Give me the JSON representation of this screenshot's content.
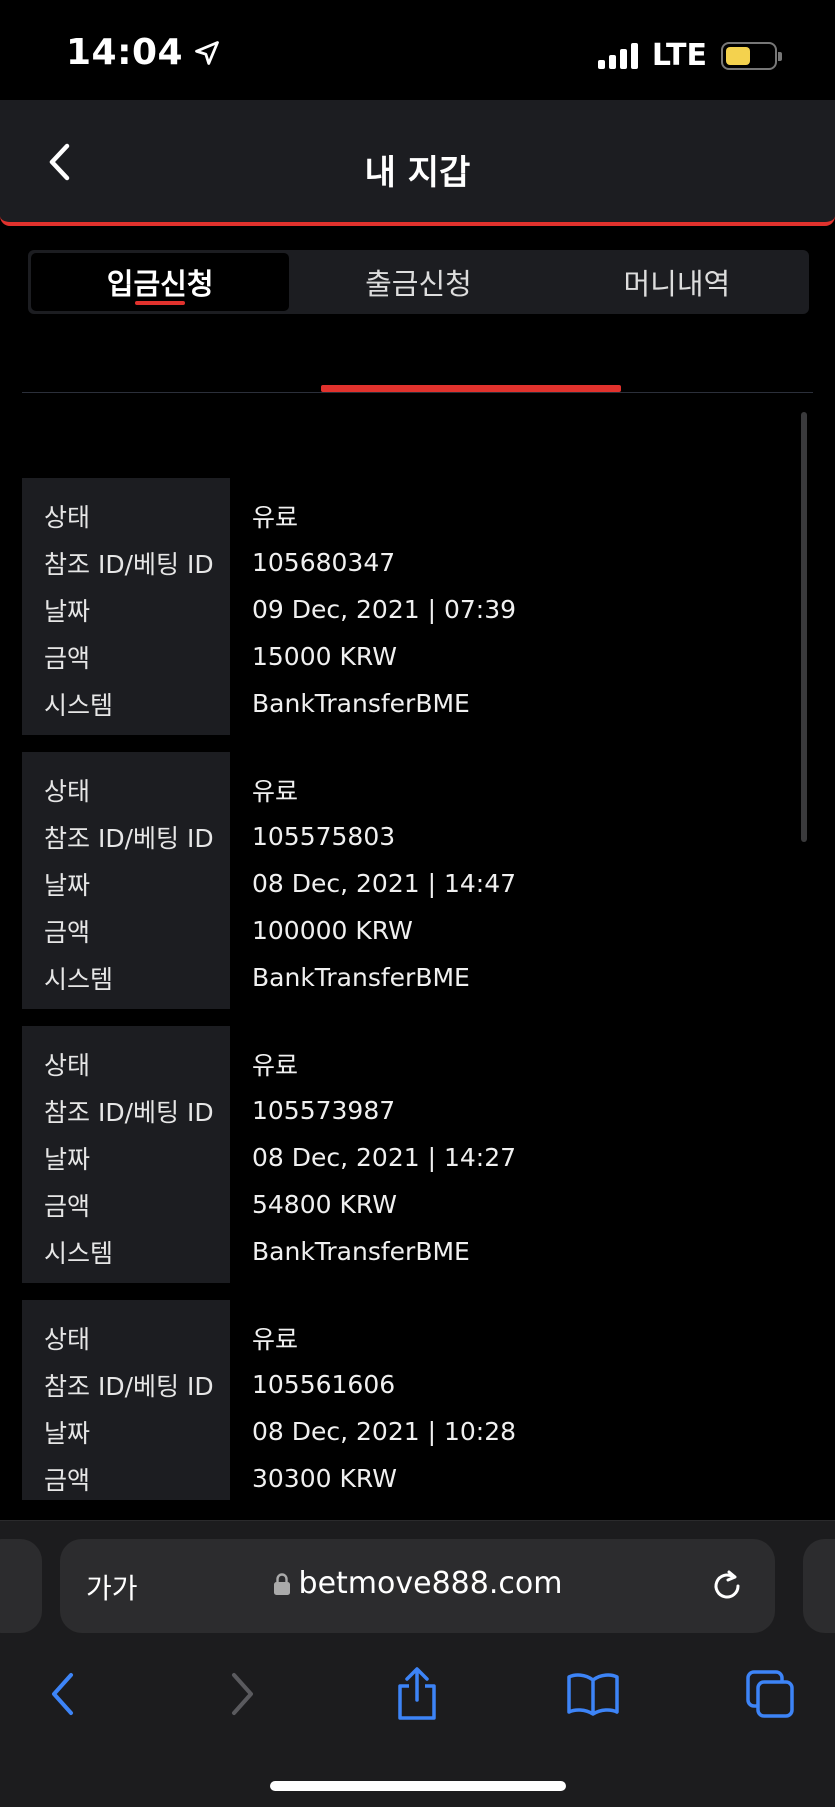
{
  "status": {
    "time": "14:04",
    "network": "LTE"
  },
  "header": {
    "title": "내 지갑"
  },
  "tabs": [
    {
      "label": "입금신청",
      "active": true
    },
    {
      "label": "출금신청",
      "active": false
    },
    {
      "label": "머니내역",
      "active": false
    }
  ],
  "labels": {
    "status": "상태",
    "ref": "참조 ID/베팅 ID",
    "date": "날짜",
    "amount": "금액",
    "system": "시스템"
  },
  "records": [
    {
      "status": "유료",
      "ref": "105680347",
      "date": "09 Dec, 2021 | 07:39",
      "amount": "15000 KRW",
      "system": "BankTransferBME"
    },
    {
      "status": "유료",
      "ref": "105575803",
      "date": "08 Dec, 2021 | 14:47",
      "amount": "100000 KRW",
      "system": "BankTransferBME"
    },
    {
      "status": "유료",
      "ref": "105573987",
      "date": "08 Dec, 2021 | 14:27",
      "amount": "54800 KRW",
      "system": "BankTransferBME"
    },
    {
      "status": "유료",
      "ref": "105561606",
      "date": "08 Dec, 2021 | 10:28",
      "amount": "30300 KRW",
      "system": ""
    }
  ],
  "browser": {
    "aa_label": "가가",
    "url": "betmove888.com"
  },
  "colors": {
    "accent": "#e1322d",
    "ios_blue": "#3d84f7",
    "battery": "#f4d24e"
  }
}
